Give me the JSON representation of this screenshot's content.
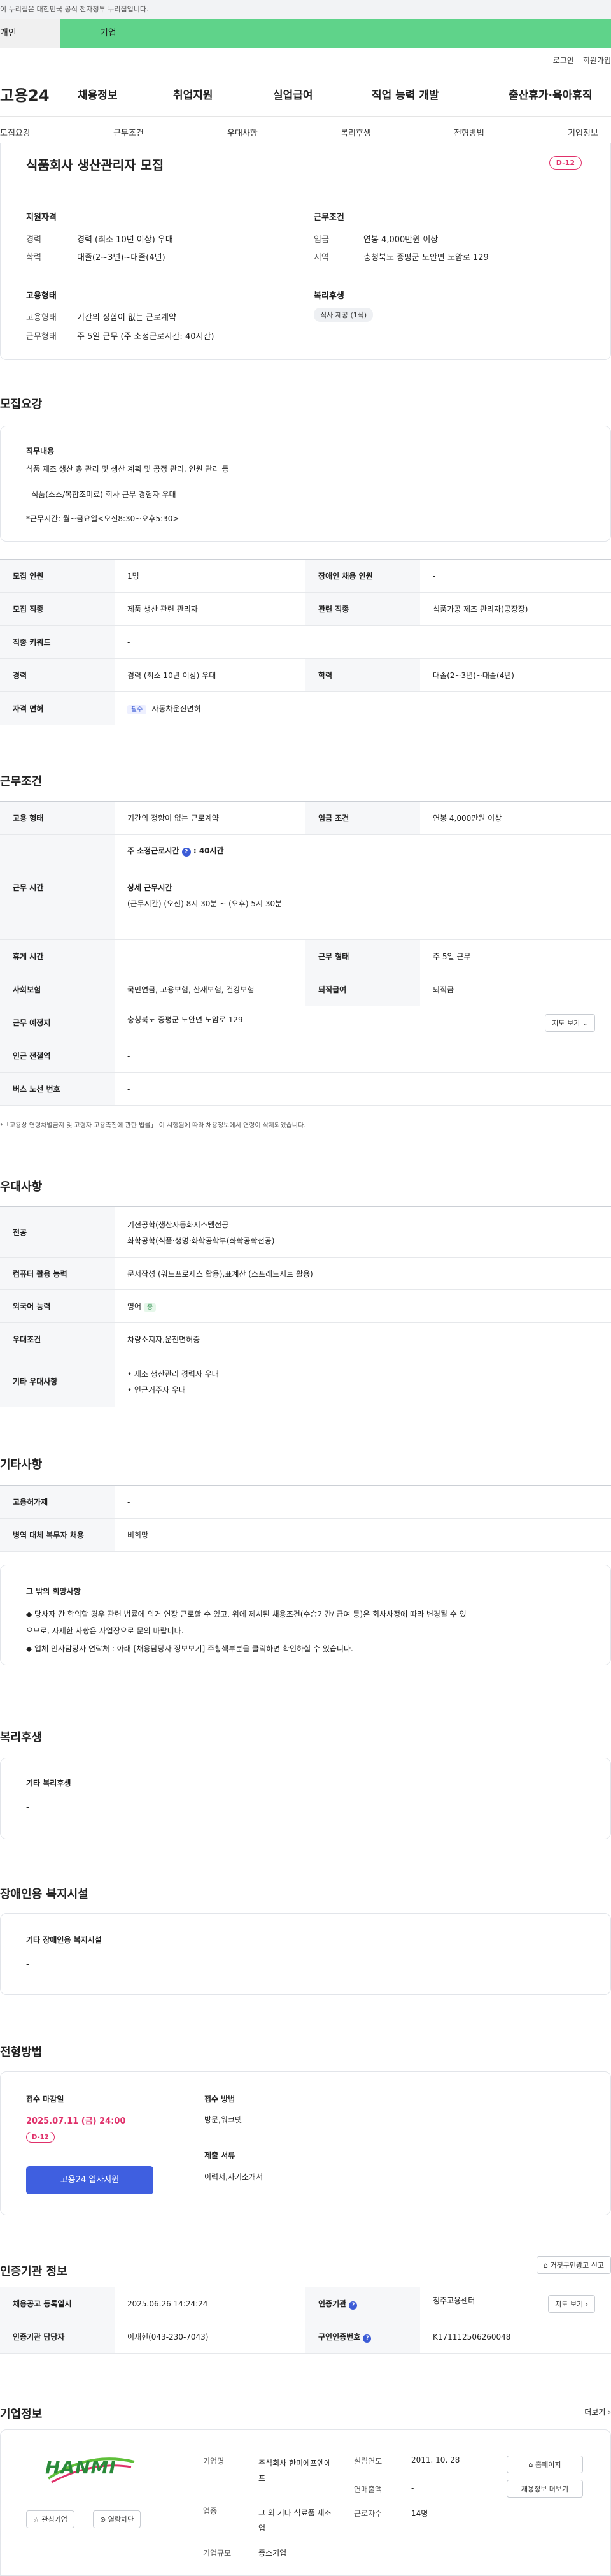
{
  "banner": {
    "text": "이 누리집은 대한민국 공식 전자정부 누리집입니다."
  },
  "user_tabs": {
    "personal": "개인",
    "company": "기업"
  },
  "utils": {
    "login": "로그인",
    "join": "회원가입"
  },
  "gnb": {
    "logo": "고용24",
    "items": [
      "채용정보",
      "취업지원",
      "실업급여",
      "직업 능력 개발",
      "출산휴가·육아휴직"
    ]
  },
  "lnb": {
    "items": [
      "모집요강",
      "근무조건",
      "우대사항",
      "복리후생",
      "전형방법",
      "기업정보"
    ]
  },
  "summary": {
    "title": "식품회사 생산관리자 모집",
    "dday": "D-12",
    "qual_title": "지원자격",
    "career_label": "경력",
    "career": "경력 (최소 10년 이상) 우대",
    "edu_label": "학력",
    "edu": "대졸(2~3년)~대졸(4년)",
    "work_title": "근무조건",
    "wage_label": "임금",
    "wage": "연봉 4,000만원 이상",
    "region_label": "지역",
    "region": "충청북도 증평군 도안면 노암로 129",
    "emp_title": "고용형태",
    "emp_type_label": "고용형태",
    "emp_type": "기간의 정함이 없는 근로계약",
    "work_shape_label": "근무형태",
    "work_shape": "주 5일 근무 (주 소정근로시간: 40시간)",
    "welfare_title": "복리후생",
    "welfare_pill": "식사 제공 (1식)"
  },
  "recruit": {
    "title": "모집요강",
    "duty_title": "직무내용",
    "duty_lines": [
      "식품 제조 생산 총 관리 및 생산 계획 및 공정 관리. 인원 관리 등",
      "- 식품(소스/복합조미료) 회사 근무 경험자 우대",
      "*근무시간: 월~금요일<오전8:30~오후5:30>"
    ],
    "rows": [
      {
        "k": "모집 인원",
        "v": "1명",
        "k2": "장애인 채용 인원",
        "v2": "-"
      },
      {
        "k": "모집 직종",
        "v": "제품 생산 관련 관리자",
        "k2": "관련 직종",
        "v2": "식품가공 제조 관리자(공장장)"
      },
      {
        "k": "직종 키워드",
        "v": "-"
      },
      {
        "k": "경력",
        "v": "경력 (최소 10년 이상) 우대",
        "k2": "학력",
        "v2": "대졸(2~3년)~대졸(4년)"
      }
    ],
    "license_label": "자격 면허",
    "license_tag": "필수",
    "license": "자동차운전면허"
  },
  "conditions": {
    "title": "근무조건",
    "emp_label": "고용 형태",
    "emp": "기간의 정함이 없는 근로계약",
    "wage_label": "임금 조건",
    "wage": "연봉 4,000만원 이상",
    "hours_label": "근무 시간",
    "hours_week": "주 소정근로시간",
    "hours_week_val": "40시간",
    "hours_detail_title": "상세 근무시간",
    "hours_detail": "(근무시간) (오전) 8시 30분 ~ (오후) 5시 30분",
    "rest_label": "휴게 시간",
    "rest": "-",
    "shape_label": "근무 형태",
    "shape": "주 5일 근무",
    "insurance_label": "사회보험",
    "insurance": "국민연금, 고용보험, 산재보험, 건강보험",
    "retire_label": "퇴직급여",
    "retire": "퇴직금",
    "place_label": "근무 예정지",
    "place": "충청북도 증평군 도안면 노암로 129",
    "map_btn": "지도 보기",
    "subway_label": "인근 전철역",
    "subway": "-",
    "bus_label": "버스 노선 번호",
    "bus": "-",
    "note": "*「고용상 연령차별금지 및 고령자 고용촉진에 관한 법률」 이 시행됨에 따라 채용정보에서 연령이 삭제되었습니다."
  },
  "pref": {
    "title": "우대사항",
    "major_label": "전공",
    "major": [
      "기전공학(생산자동화시스템전공",
      "화학공학(식품·생명·화학공학부(화학공학전공)"
    ],
    "pc_label": "컴퓨터 활용 능력",
    "pc": "문서작성 (워드프로세스 활용),표계산 (스프레드시트 활용)",
    "lang_label": "외국어 능력",
    "lang": "영어",
    "lang_level": "중",
    "cond_label": "우대조건",
    "cond": "차량소지자,운전면허증",
    "etc_label": "기타 우대사항",
    "etc": [
      "• 제조 생산관리 경력자 우대",
      "• 인근거주자 우대"
    ]
  },
  "other": {
    "title": "기타사항",
    "emp_permit_label": "고용허가제",
    "emp_permit": "-",
    "military_label": "병역 대체 복무자 채용",
    "military": "비희망",
    "box_title": "그 밖의 희망사항",
    "box_lines": [
      "◆ 당사자 간 합의할 경우 관련 법률에 의거 연장 근로할 수 있고, 위에 제시된 채용조건(수습기간/ 급여 등)은 회사사정에 따라 변경될 수 있",
      "으므로, 자세한 사항은 사업장으로 문의 바랍니다.",
      "◆ 업체 인사담당자 연락처 : 아래 [채용담당자 정보보기] 주황색부분을 클릭하면 확인하실 수 있습니다."
    ]
  },
  "welfare": {
    "title": "복리후생",
    "box_title": "기타 복리후생",
    "box_value": "-"
  },
  "disability": {
    "title": "장애인용 복지시설",
    "box_title": "기타 장애인용 복지시설",
    "box_value": "-"
  },
  "selection": {
    "title": "전형방법",
    "deadline_title": "접수 마감일",
    "deadline": "2025.07.11 (금) 24:00",
    "dday": "D-12",
    "apply_btn": "고용24 입사지원",
    "method_title": "접수 방법",
    "method": "방문,워크넷",
    "docs_title": "제출 서류",
    "docs": "이력서,자기소개서"
  },
  "agency": {
    "title": "인증기관 정보",
    "report_btn": "거짓구인광고 신고",
    "date_label": "채용공고 등록일시",
    "date": "2025.06.26 14:24:24",
    "agency_label": "인증기관",
    "agency": "청주고용센터",
    "map_btn": "지도 보기",
    "manager_label": "인증기관 담당자",
    "manager": "이재헌(043-230-7043)",
    "reg_label": "구인인증번호",
    "reg": "K171112506260048"
  },
  "company": {
    "title": "기업정보",
    "more": "더보기",
    "logo_text": "HANMI",
    "fav_btn": "관심기업",
    "unfollow_btn": "열람차단",
    "name_label": "기업명",
    "name": "주식회사 한미에프엔에프",
    "industry_label": "업종",
    "industry": "그 외 기타 식료품 제조업",
    "scale_label": "기업규모",
    "scale": "중소기업",
    "founded_label": "설립연도",
    "founded": "2011. 10. 28",
    "sales_label": "연매출액",
    "sales": "-",
    "staff_label": "근로자수",
    "staff": "14명",
    "home_btn": "홈페이지",
    "jobs_btn": "채용정보 더보기"
  },
  "colors": {
    "accent": "#3b5bd6",
    "dday": "#e0306a",
    "tab_green": "#5fd38a"
  }
}
